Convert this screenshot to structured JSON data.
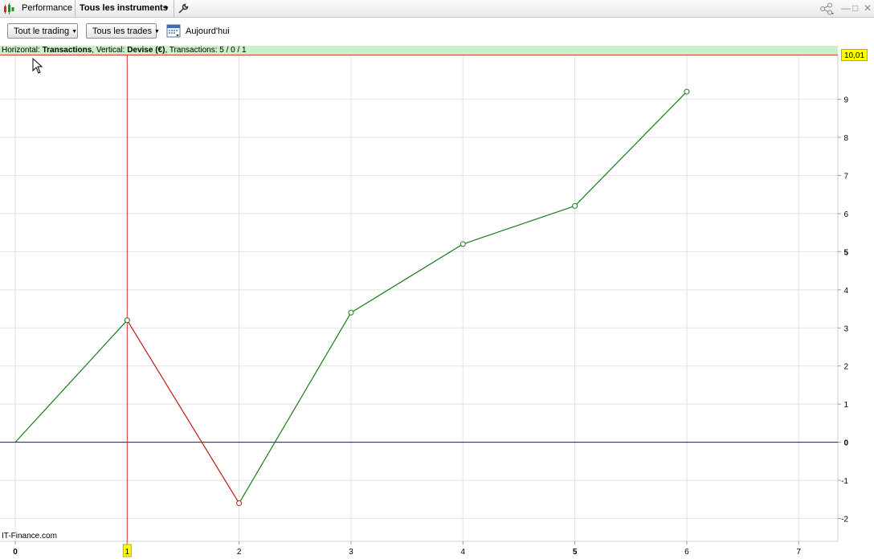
{
  "topbar": {
    "title": "Performance",
    "instruments_label": "Tous les instruments",
    "instruments_arrow": "▾"
  },
  "toolbar": {
    "trading_filter": "Tout le trading",
    "trades_filter": "Tous les trades",
    "date_label": "Aujourd'hui"
  },
  "infobar": {
    "horizontal_label": "Horizontal: ",
    "horizontal_value": "Transactions",
    "vertical_label": ", Vertical: ",
    "vertical_value": "Devise (€)",
    "transactions_label": ", Transactions: ",
    "transactions_value": "5 / 0 / 1"
  },
  "value_badge": "10,01",
  "credit": "IT-Finance.com",
  "colors": {
    "gain": "#1a7a1a",
    "loss": "#c01818",
    "crosshair": "#e03030",
    "grid": "#e2e2e2",
    "zero_line": "#202040",
    "infobar_bg": "#c9f0c6",
    "badge": "#ffff00"
  },
  "chart_data": {
    "type": "line",
    "x": [
      0,
      1,
      2,
      3,
      4,
      5,
      6
    ],
    "y": [
      0,
      3.2,
      -1.6,
      3.4,
      5.2,
      6.2,
      9.2
    ],
    "xlim": [
      0,
      7.35
    ],
    "ylim": [
      -2.6,
      10.15
    ],
    "x_ticks": [
      "0",
      "1",
      "2",
      "3",
      "4",
      "5",
      "6",
      "7"
    ],
    "y_ticks": [
      "9",
      "8",
      "7",
      "6",
      "5",
      "4",
      "3",
      "2",
      "1",
      "0",
      "-1",
      "-2"
    ],
    "bold_x_ticks": [
      "0",
      "5"
    ],
    "bold_y_ticks": [
      "5",
      "0"
    ],
    "highlighted_x": 1,
    "highlighted_x_label": "1",
    "grid": true
  }
}
